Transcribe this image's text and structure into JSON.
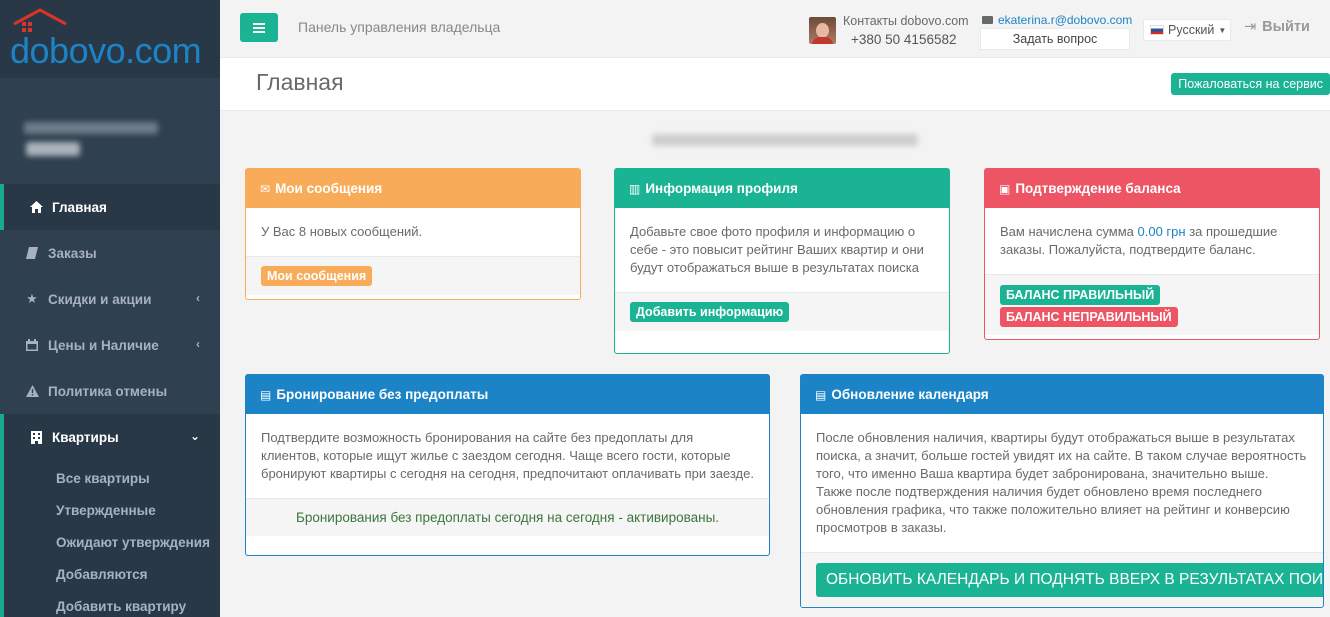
{
  "brand": {
    "logo_text": "dobovo.com"
  },
  "sidebar": {
    "items": [
      {
        "label": "Главная",
        "icon": "home-icon"
      },
      {
        "label": "Заказы",
        "icon": "book-icon"
      },
      {
        "label": "Скидки и акции",
        "icon": "star-icon"
      },
      {
        "label": "Цены и Наличие",
        "icon": "calendar-icon"
      },
      {
        "label": "Политика отмены",
        "icon": "warning-icon"
      },
      {
        "label": "Квартиры",
        "icon": "building-icon"
      }
    ],
    "submenu": [
      "Все квартиры",
      "Утвержденные",
      "Ожидают утверждения",
      "Добавляются",
      "Добавить квартиру"
    ]
  },
  "topbar": {
    "panel_title": "Панель управления владельца",
    "contacts_label": "Контакты dobovo.com",
    "phone": "+380 50 4156582",
    "email": "ekaterina.r@dobovo.com",
    "ask_button": "Задать вопрос",
    "language": "Русский",
    "logout": "Выйти"
  },
  "page": {
    "title": "Главная",
    "complain_button": "Пожаловаться на сервис"
  },
  "panels": {
    "messages": {
      "title": "Мои сообщения",
      "body": "У Вас 8 новых сообщений.",
      "button": "Мои сообщения"
    },
    "profile": {
      "title": "Информация профиля",
      "body": "Добавьте свое фото профиля и информацию о себе - это повысит рейтинг Ваших квартир и они будут отображаться выше в результатах поиска",
      "button": "Добавить информацию"
    },
    "balance": {
      "title": "Подтверждение баланса",
      "body_before": "Вам начислена сумма ",
      "amount": "0.00 грн",
      "body_after": " за прошедшие заказы. Пожалуйста, подтвердите баланс.",
      "btn_correct": "БАЛАНС ПРАВИЛЬНЫЙ",
      "btn_incorrect": "БАЛАНС НЕПРАВИЛЬНЫЙ"
    },
    "booking": {
      "title": "Бронирование без предоплаты",
      "body": "Подтвердите возможность бронирования на сайте без предоплаты для клиентов, которые ищут жилье с заездом сегодня. Чаще всего гости, которые бронируют квартиры с сегодня на сегодня, предпочитают оплачивать при заезде.",
      "status": "Бронирования без предоплаты сегодня на сегодня - активированы."
    },
    "calendar": {
      "title": "Обновление календаря",
      "body": "После обновления наличия, квартиры будут отображаться выше в результатах поиска, а значит, больше гостей увидят их на сайте. В таком случае вероятность того, что именно Ваша квартира будет забронирована, значительно выше. Также после подтверждения наличия будет обновлено время последнего обновления графика, что также положительно влияет на рейтинг и конверсию просмотров в заказы.",
      "button": "ОБНОВИТЬ КАЛЕНДАРЬ И ПОДНЯТЬ ВВЕРХ В РЕЗУЛЬТАТАХ ПОИСКА"
    }
  },
  "colors": {
    "primary": "#1ab394",
    "warning": "#f8ac59",
    "danger": "#ed5565",
    "info": "#1c84c6",
    "sidebar": "#2f4050",
    "success_text": "#3c763d"
  }
}
